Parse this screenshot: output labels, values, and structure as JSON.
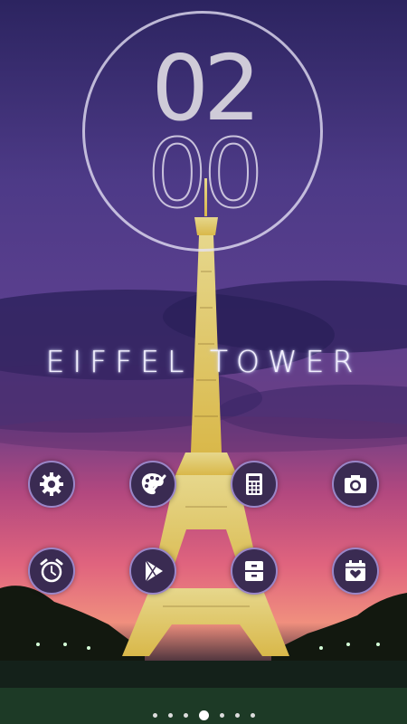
{
  "clock": {
    "hour": "02",
    "minute": "00"
  },
  "title": "EIFFEL TOWER",
  "icons": [
    {
      "name": "settings-icon"
    },
    {
      "name": "paint-palette-icon"
    },
    {
      "name": "calculator-icon"
    },
    {
      "name": "camera-icon"
    },
    {
      "name": "alarm-clock-icon"
    },
    {
      "name": "play-store-icon"
    },
    {
      "name": "file-cabinet-icon"
    },
    {
      "name": "heart-calendar-icon"
    }
  ],
  "pager": {
    "count": 7,
    "active_index": 3
  },
  "colors": {
    "icon_fill": "#3a2b52",
    "icon_border": "#9a86c8",
    "icon_glyph": "#ffffff"
  }
}
